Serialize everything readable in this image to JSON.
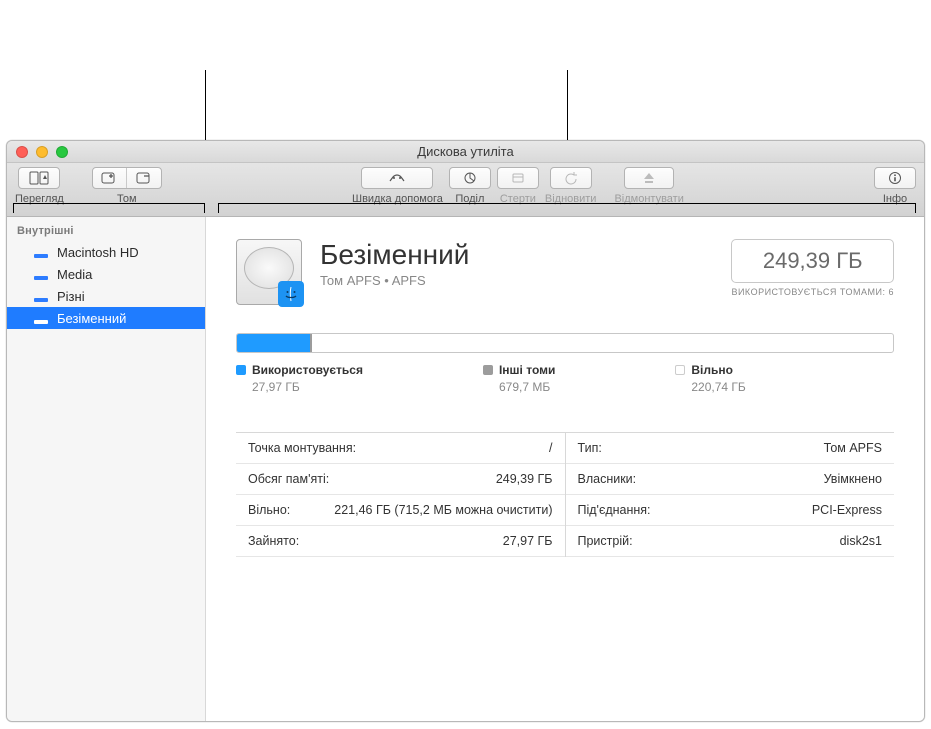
{
  "window": {
    "title": "Дискова утиліта"
  },
  "toolbar": {
    "view_label": "Перегляд",
    "volume_label": "Том",
    "firstaid_label": "Швидка допомога",
    "partition_label": "Поділ",
    "erase_label": "Стерти",
    "restore_label": "Відновити",
    "unmount_label": "Відмонтувати",
    "info_label": "Інфо"
  },
  "sidebar": {
    "internal_header": "Внутрішні",
    "items": [
      {
        "label": "Macintosh HD"
      },
      {
        "label": "Media"
      },
      {
        "label": "Різні"
      },
      {
        "label": "Безіменний"
      }
    ]
  },
  "volume": {
    "name": "Безіменний",
    "subtitle": "Том APFS • APFS",
    "capacity": "249,39 ГБ",
    "capacity_sub": "ВИКОРИСТОВУЄТЬСЯ ТОМАМИ: 6"
  },
  "usage": {
    "used_label": "Використовується",
    "used_value": "27,97 ГБ",
    "other_label": "Інші томи",
    "other_value": "679,7 МБ",
    "free_label": "Вільно",
    "free_value": "220,74 ГБ",
    "used_pct": 11.2,
    "other_pct": 0.3
  },
  "info": {
    "left": [
      {
        "k": "Точка монтування:",
        "v": "/"
      },
      {
        "k": "Обсяг пам'яті:",
        "v": "249,39 ГБ"
      },
      {
        "k": "Вільно:",
        "v": "221,46 ГБ (715,2 МБ можна очистити)"
      },
      {
        "k": "Зайнято:",
        "v": "27,97 ГБ"
      }
    ],
    "right": [
      {
        "k": "Тип:",
        "v": "Том APFS"
      },
      {
        "k": "Власники:",
        "v": "Увімкнено"
      },
      {
        "k": "Під'єднання:",
        "v": "PCI-Express"
      },
      {
        "k": "Пристрій:",
        "v": "disk2s1"
      }
    ]
  }
}
